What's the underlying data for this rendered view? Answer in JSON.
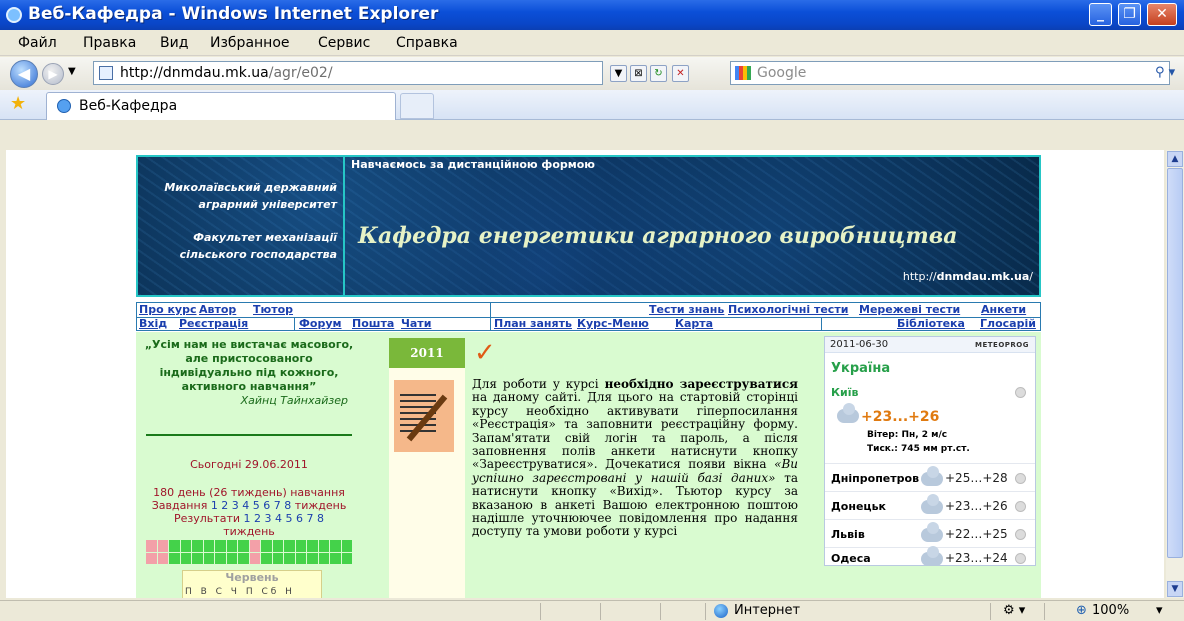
{
  "window": {
    "title": "Веб-Кафедра - Windows Internet Explorer"
  },
  "menu": [
    "Файл",
    "Правка",
    "Вид",
    "Избранное",
    "Сервис",
    "Справка"
  ],
  "address": {
    "host": "http://dnmdau.mk.ua",
    "path": "/agr/e02/"
  },
  "search": {
    "placeholder": "Google"
  },
  "tab": {
    "label": "Веб-Кафедра"
  },
  "banner": {
    "university": "Миколаївський державний аграрний університет",
    "faculty": "Факультет механізації сільського господарства",
    "top": "Навчаємось за дистанційною формою",
    "title": "Кафедра енергетики аграрного виробництва",
    "url_prefix": "http://",
    "url_bold": "dnmdau.mk.ua",
    "url_suffix": "/"
  },
  "nav": {
    "row1_left": [
      "Про курс",
      "Автор",
      "Тютор"
    ],
    "row1_right": [
      "Тести знань",
      "Психологічні тести",
      "Мережеві тести",
      "Анкети"
    ],
    "row2_a": [
      "Вхід",
      "Реєстрація"
    ],
    "row2_b": [
      "Форум",
      "Пошта",
      "Чати"
    ],
    "row2_c": [
      "План занять",
      "Курс-Меню",
      "Карта"
    ],
    "row2_d": [
      "Бібліотека",
      "Глосарій"
    ]
  },
  "left": {
    "quote": "„Усім нам не вистачає масового, але пристосованого індивідуально під кожного, активного навчання”",
    "quote_author": "Хайнц Тайнхайзер",
    "today": "Сьогодні 29.06.2011",
    "day_line": "180 день (26 тиждень) навчання",
    "tasks_label": "Завдання",
    "tasks_numbers": "1 2 3 4 5 6 7 8",
    "tasks_suffix": "тиждень",
    "results_label": "Результати",
    "results_numbers": "1 2 3 4 5 6 7 8",
    "results_suffix": "тиждень",
    "calendar_month": "Червень",
    "calendar_days": "П В С Ч П Сб Н"
  },
  "article": {
    "year": "2011",
    "p1": "Для роботи у курсі",
    "p1_bold": "необхідно зареєструватися",
    "p2": "на даному сайті. Для цього на стартовій сторінці курсу необхідно активувати гіперпосилання «Реєстрація» та заповнити реєстраційну форму. Запам'ятати свій логін та пароль, а після заповнення полів анкети натиснути кнопку «Зареєструватися». Дочекатися появи вікна",
    "p3_italic": "«Ви успішно зареєстровані у нашій базі даних»",
    "p4": "та натиснути кнопку «Вихід». Тьютор курсу за вказаною в анкеті Вашою електронною поштою надішле уточнюючее повідомлення про надання доступу та",
    "p5_cut": "умови роботи у курсі"
  },
  "weather": {
    "date": "2011-06-30",
    "brand": "METEOPROG",
    "country": "Україна",
    "main_city": "Київ",
    "main_temp": "+23...+26",
    "wind": "Вітер: Пн, 2 м/с",
    "pressure": "Тиск.: 745 мм рт.ст.",
    "cities": [
      {
        "name": "Дніпропетровськ",
        "temp": "+25…+28"
      },
      {
        "name": "Донецьк",
        "temp": "+23…+26"
      },
      {
        "name": "Львів",
        "temp": "+22…+25"
      },
      {
        "name": "Одеса",
        "temp": "+23…+24"
      }
    ]
  },
  "status": {
    "zone": "Интернет",
    "zoom": "100%"
  }
}
